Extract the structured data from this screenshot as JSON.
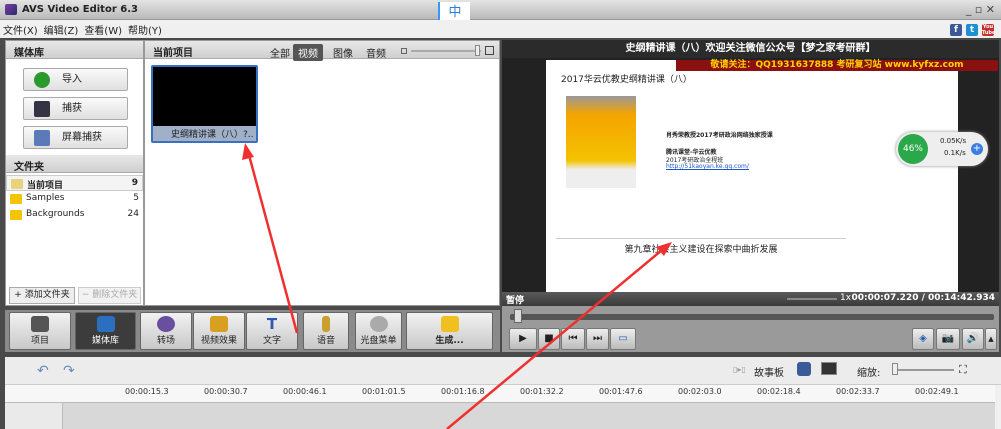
{
  "window": {
    "title": "AVS Video Editor 6.3",
    "ime": "中",
    "controls": "_ ▫ ✕"
  },
  "menu": [
    "文件(X)",
    "编辑(Z)",
    "查看(W)",
    "帮助(Y)"
  ],
  "social": [
    "f",
    "t",
    "You Tube"
  ],
  "media_library": {
    "title": "媒体库",
    "buttons": [
      "导入",
      "捕获",
      "屏幕捕获"
    ]
  },
  "folders": {
    "title": "文件夹",
    "items": [
      {
        "name": "当前项目",
        "count": "9"
      },
      {
        "name": "Samples",
        "count": "5"
      },
      {
        "name": "Backgrounds",
        "count": "24"
      }
    ],
    "add": "+ 添加文件夹",
    "remove": "− 删除文件夹"
  },
  "current_project": {
    "title": "当前项目",
    "tabs": [
      "全部",
      "视频",
      "图像",
      "音频"
    ],
    "active_tab": "视频",
    "clip": "史纲精讲课（八）?.."
  },
  "preview": {
    "title": "史纲精讲课（八）欢迎关注微信公众号【梦之家考研群】",
    "banner": "敬请关注：QQ1931637888 考研复习站 www.kyfxz.com",
    "slide_title": "2017华云优教史纲精讲课（八）",
    "slide_lines": [
      "肖秀荣教授2017考研政治网络独家授课",
      "腾讯课堂-华云优教",
      "2017考研政治全程班",
      "http://51kaoyan.ke.qq.com/"
    ],
    "chapter": "第九章社会主义建设在探索中曲折发展",
    "net": {
      "percent": "46%",
      "up": "0.05K/s",
      "down": "0.1K/s"
    },
    "state": "暂停",
    "speed": "1x",
    "time": "00:00:07.220 / 00:14:42.934",
    "progress": 0.008
  },
  "toolbar": [
    "项目",
    "媒体库",
    "转场",
    "视频效果",
    "文字",
    "语音",
    "光盘菜单",
    "生成..."
  ],
  "timeline": {
    "storyboard": "故事板",
    "zoom": "缩放:",
    "ticks": [
      "00:00:15.3",
      "00:00:30.7",
      "00:00:46.1",
      "00:01:01.5",
      "00:01:16.8",
      "00:01:32.2",
      "00:01:47.6",
      "00:02:03.0",
      "00:02:18.4",
      "00:02:33.7",
      "00:02:49.1"
    ]
  }
}
